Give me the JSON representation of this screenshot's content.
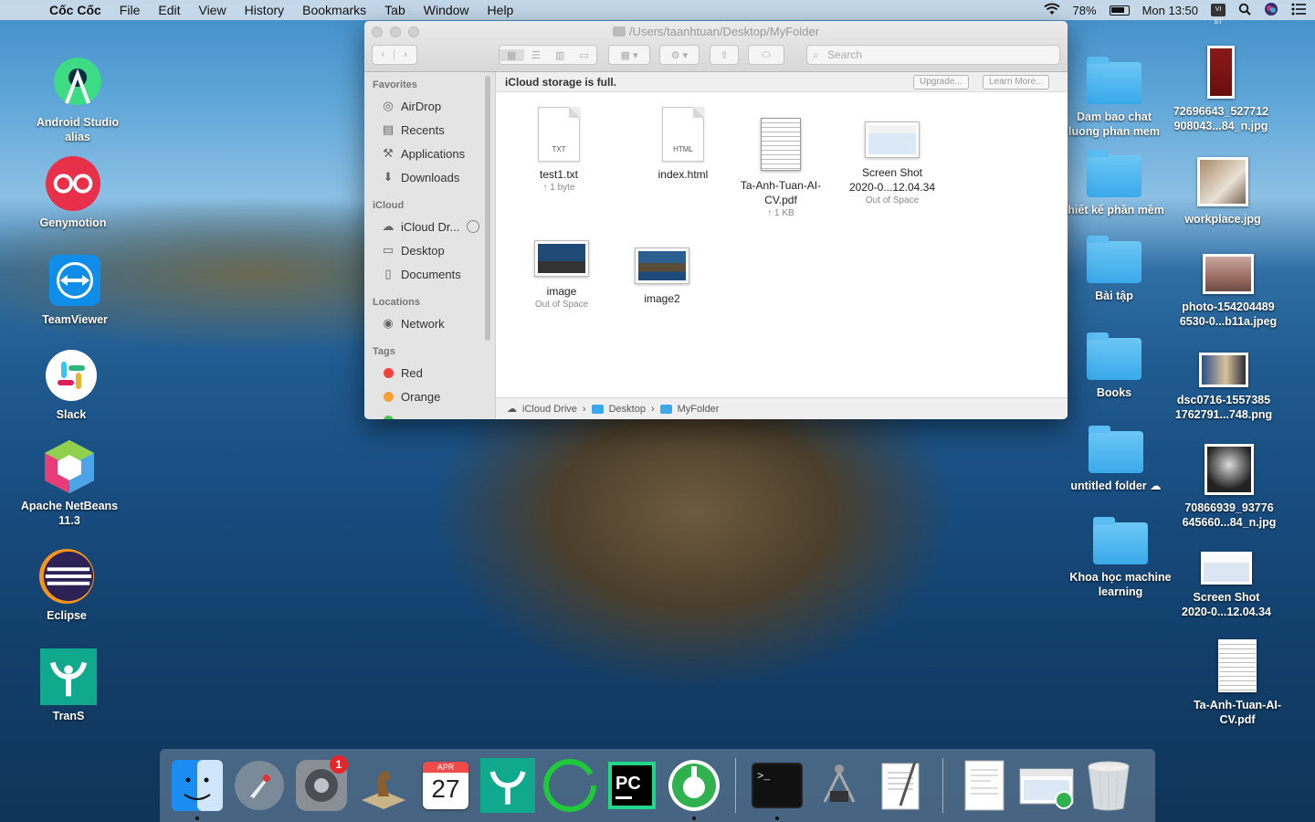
{
  "menubar": {
    "app_name": "Cốc Cốc",
    "items": [
      "File",
      "Edit",
      "View",
      "History",
      "Bookmarks",
      "Tab",
      "Window",
      "Help"
    ],
    "battery": "78%",
    "clock": "Mon 13:50",
    "input_source": "VI ST"
  },
  "desktop_left": [
    {
      "label_1": "Android Studio",
      "label_2": "alias"
    },
    {
      "label_1": "Genymotion"
    },
    {
      "label_1": "TeamViewer"
    },
    {
      "label_1": "Slack"
    },
    {
      "label_1": "Apache NetBeans",
      "label_2": "11.3"
    },
    {
      "label_1": "Eclipse"
    },
    {
      "label_1": "TranS"
    }
  ],
  "desktop_right_folders": [
    {
      "label_1": "Dam bao chat",
      "label_2": "luong phan mem"
    },
    {
      "label_1": "thiết kế phần mềm"
    },
    {
      "label_1": "Bài tập"
    },
    {
      "label_1": "Books"
    },
    {
      "label_1": "untitled folder"
    },
    {
      "label_1": "Khoa học machine",
      "label_2": "learning"
    }
  ],
  "desktop_right_files": [
    {
      "label_1": "72696643_527712",
      "label_2": "908043...84_n.jpg"
    },
    {
      "label_1": "workplace.jpg"
    },
    {
      "label_1": "photo-154204489",
      "label_2": "6530-0...b11a.jpeg"
    },
    {
      "label_1": "dsc0716-1557385",
      "label_2": "1762791...748.png"
    },
    {
      "label_1": "70866939_93776",
      "label_2": "645660...84_n.jpg"
    },
    {
      "label_1": "Screen Shot",
      "label_2": "2020-0...12.04.34"
    },
    {
      "label_1": "Ta-Anh-Tuan-AI-",
      "label_2": "CV.pdf"
    }
  ],
  "finder": {
    "title": "/Users/taanhtuan/Desktop/MyFolder",
    "search_placeholder": "Search",
    "icloud_message": "iCloud storage is full.",
    "upgrade_label": "Upgrade...",
    "learn_more_label": "Learn More...",
    "sidebar": {
      "favorites_heading": "Favorites",
      "favorites": [
        "AirDrop",
        "Recents",
        "Applications",
        "Downloads"
      ],
      "icloud_heading": "iCloud",
      "icloud": [
        "iCloud Dr...",
        "Desktop",
        "Documents"
      ],
      "locations_heading": "Locations",
      "locations": [
        "Network"
      ],
      "tags_heading": "Tags",
      "tags": [
        {
          "name": "Red",
          "color": "#f5413c"
        },
        {
          "name": "Orange",
          "color": "#f6a03a"
        }
      ]
    },
    "files": [
      {
        "name": "test1.txt",
        "sub": "↑ 1 byte",
        "ext": "TXT"
      },
      {
        "name": "index.html",
        "sub": "",
        "ext": "HTML"
      },
      {
        "name_1": "Ta-Anh-Tuan-AI-",
        "name_2": "CV.pdf",
        "sub": "↑ 1 KB"
      },
      {
        "name_1": "Screen Shot",
        "name_2": "2020-0...12.04.34",
        "sub": "Out of Space"
      },
      {
        "name": "image",
        "sub": "Out of Space"
      },
      {
        "name": "image2",
        "sub": ""
      }
    ],
    "path": [
      "iCloud Drive",
      "Desktop",
      "MyFolder"
    ]
  },
  "dock": {
    "calendar_month": "APR",
    "calendar_day": "27",
    "mail_badge": "1"
  }
}
